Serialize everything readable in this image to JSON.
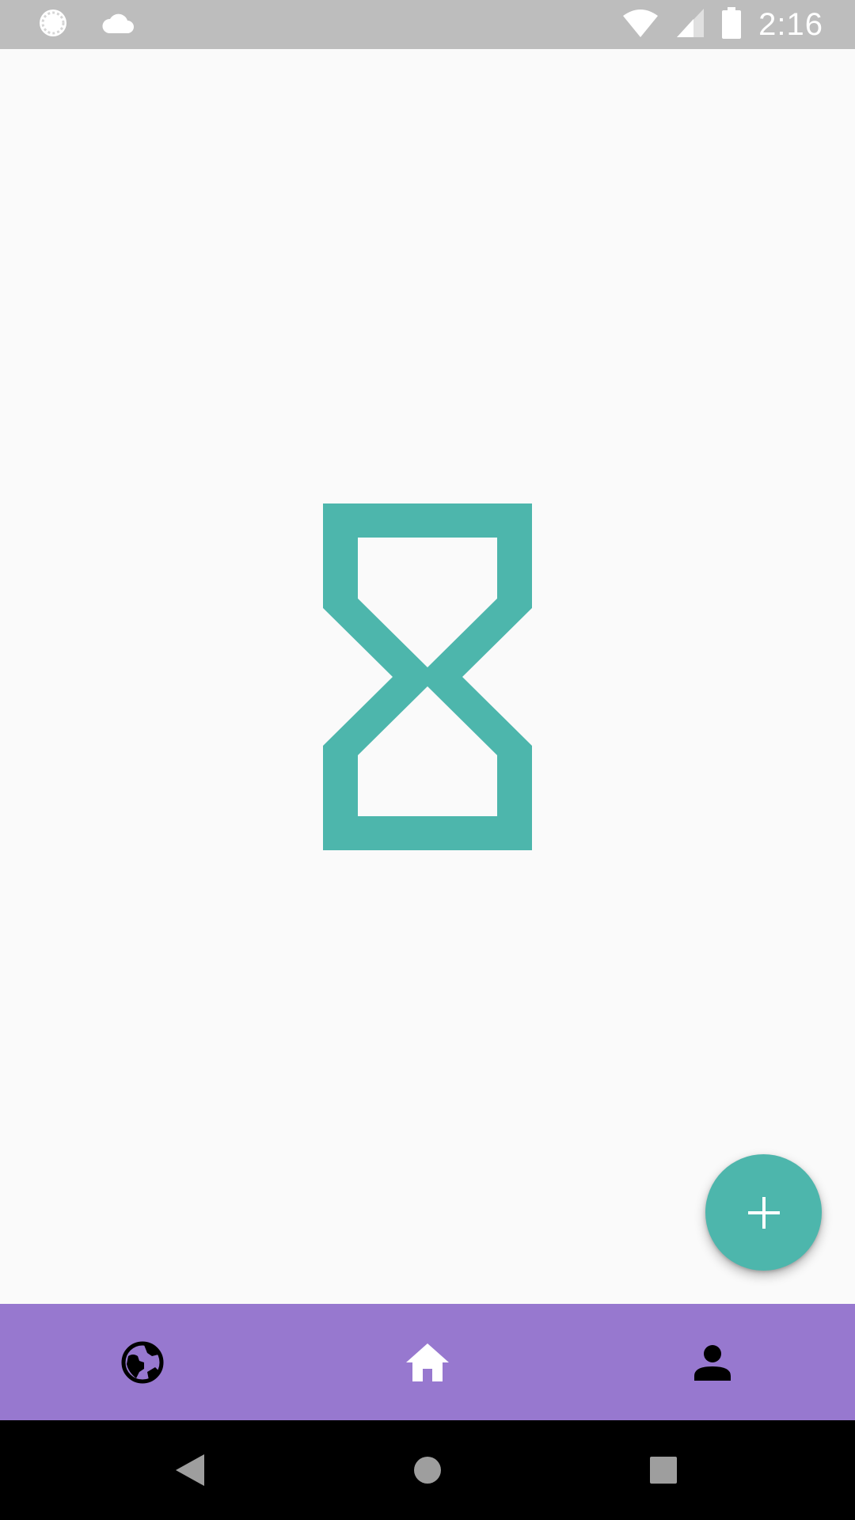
{
  "status_bar": {
    "time": "2:16",
    "left_icons": [
      "sync-indicator-icon",
      "cloud-icon"
    ],
    "right_icons": [
      "wifi-icon",
      "cell-signal-icon",
      "battery-icon"
    ]
  },
  "main": {
    "loading_icon": "hourglass-icon",
    "accent_color": "#4db6ac"
  },
  "fab": {
    "icon": "plus-icon",
    "color": "#4db6ac"
  },
  "bottom_nav": {
    "background": "#9778cf",
    "items": [
      {
        "icon": "globe-icon",
        "active": false
      },
      {
        "icon": "home-icon",
        "active": true
      },
      {
        "icon": "person-icon",
        "active": false
      }
    ]
  },
  "system_nav": {
    "buttons": [
      "back-icon",
      "home-circle-icon",
      "recents-icon"
    ]
  }
}
